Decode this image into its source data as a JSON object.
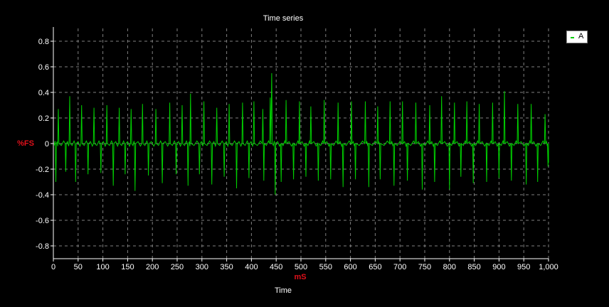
{
  "chart_data": {
    "type": "line",
    "title": "Time series",
    "xlabel": "Time",
    "xunit": "mS",
    "yunit": "%FS",
    "xlim": [
      0,
      1000
    ],
    "ylim": [
      -0.9,
      0.9
    ],
    "x_ticks": [
      "0",
      "50",
      "100",
      "150",
      "200",
      "250",
      "300",
      "350",
      "400",
      "450",
      "500",
      "550",
      "600",
      "650",
      "700",
      "750",
      "800",
      "850",
      "900",
      "950",
      "1,000"
    ],
    "y_ticks": [
      "0.8",
      "0.6",
      "0.4",
      "0.2",
      "0",
      "-0.2",
      "-0.4",
      "-0.6",
      "-0.8"
    ],
    "grid": true,
    "legend_position": "top-right",
    "colors": {
      "background": "#000000",
      "grid": "#808080",
      "series": "#00d000",
      "unit_label": "#e0101a"
    },
    "series": [
      {
        "name": "A",
        "description": "periodic pulse waveform, about 45 cycles over 1000 mS; each cycle has a positive spike followed by a negative spike",
        "approx_period": 22,
        "peaks": [
          [
            10,
            0.27
          ],
          [
            33,
            0.37
          ],
          [
            57,
            0.3
          ],
          [
            82,
            0.28
          ],
          [
            108,
            0.3
          ],
          [
            133,
            0.28
          ],
          [
            157,
            0.27
          ],
          [
            180,
            0.31
          ],
          [
            207,
            0.27
          ],
          [
            235,
            0.32
          ],
          [
            260,
            0.3
          ],
          [
            277,
            0.39
          ],
          [
            304,
            0.33
          ],
          [
            330,
            0.28
          ],
          [
            355,
            0.31
          ],
          [
            382,
            0.32
          ],
          [
            405,
            0.33
          ],
          [
            423,
            0.27
          ],
          [
            438,
            0.36
          ],
          [
            441,
            0.55
          ],
          [
            470,
            0.34
          ],
          [
            497,
            0.33
          ],
          [
            520,
            0.29
          ],
          [
            547,
            0.34
          ],
          [
            575,
            0.32
          ],
          [
            602,
            0.33
          ],
          [
            630,
            0.33
          ],
          [
            655,
            0.29
          ],
          [
            680,
            0.33
          ],
          [
            705,
            0.33
          ],
          [
            732,
            0.32
          ],
          [
            760,
            0.3
          ],
          [
            784,
            0.37
          ],
          [
            810,
            0.32
          ],
          [
            835,
            0.33
          ],
          [
            860,
            0.31
          ],
          [
            887,
            0.32
          ],
          [
            911,
            0.41
          ],
          [
            938,
            0.31
          ],
          [
            965,
            0.31
          ],
          [
            993,
            0.23
          ]
        ],
        "troughs": [
          [
            5,
            -0.3
          ],
          [
            25,
            -0.22
          ],
          [
            45,
            -0.3
          ],
          [
            70,
            -0.24
          ],
          [
            96,
            -0.23
          ],
          [
            121,
            -0.33
          ],
          [
            145,
            -0.24
          ],
          [
            165,
            -0.37
          ],
          [
            192,
            -0.25
          ],
          [
            220,
            -0.31
          ],
          [
            248,
            -0.24
          ],
          [
            272,
            -0.33
          ],
          [
            295,
            -0.24
          ],
          [
            320,
            -0.32
          ],
          [
            345,
            -0.26
          ],
          [
            370,
            -0.35
          ],
          [
            395,
            -0.27
          ],
          [
            425,
            -0.29
          ],
          [
            448,
            -0.4
          ],
          [
            460,
            -0.3
          ],
          [
            485,
            -0.28
          ],
          [
            510,
            -0.26
          ],
          [
            535,
            -0.29
          ],
          [
            560,
            -0.28
          ],
          [
            585,
            -0.34
          ],
          [
            610,
            -0.28
          ],
          [
            637,
            -0.34
          ],
          [
            660,
            -0.28
          ],
          [
            688,
            -0.33
          ],
          [
            715,
            -0.29
          ],
          [
            745,
            -0.36
          ],
          [
            770,
            -0.3
          ],
          [
            800,
            -0.36
          ],
          [
            823,
            -0.26
          ],
          [
            848,
            -0.31
          ],
          [
            875,
            -0.3
          ],
          [
            900,
            -0.27
          ],
          [
            925,
            -0.29
          ],
          [
            955,
            -0.32
          ],
          [
            978,
            -0.3
          ],
          [
            999,
            -0.18
          ]
        ]
      }
    ]
  }
}
